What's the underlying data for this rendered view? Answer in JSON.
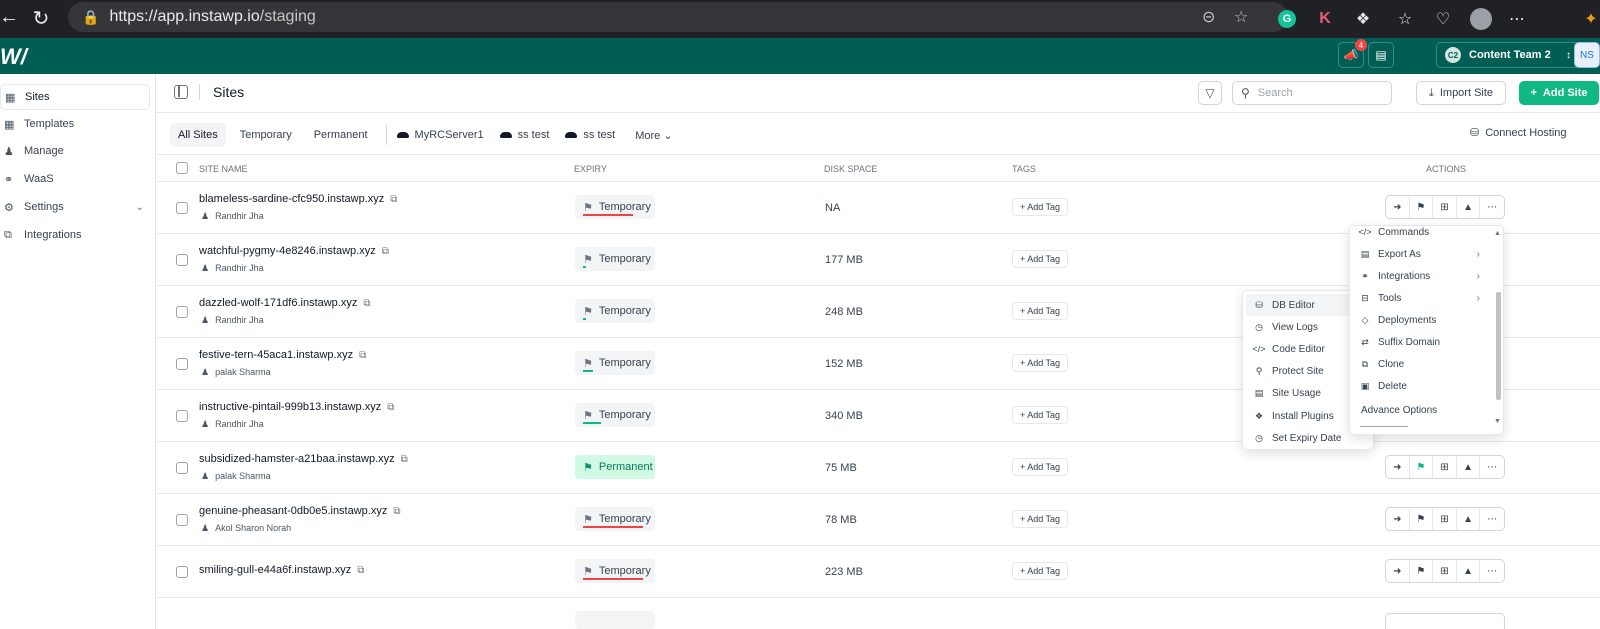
{
  "browser": {
    "url_host": "https://app.instawp.io",
    "url_path": "/staging"
  },
  "header": {
    "notifications_count": "4",
    "team_initials": "C2",
    "team_name": "Content Team 2",
    "user_initials": "NS"
  },
  "sidebar": {
    "items": [
      {
        "label": "Sites",
        "icon": "table-icon"
      },
      {
        "label": "Templates",
        "icon": "grid-icon"
      },
      {
        "label": "Manage",
        "icon": "users-icon"
      },
      {
        "label": "WaaS",
        "icon": "planet-icon"
      },
      {
        "label": "Settings",
        "icon": "gear-icon"
      },
      {
        "label": "Integrations",
        "icon": "plug-icon"
      }
    ]
  },
  "page": {
    "title": "Sites",
    "search_placeholder": "Search",
    "import_label": "Import Site",
    "add_label": "Add Site",
    "connect_label": "Connect Hosting"
  },
  "tabs": [
    "All Sites",
    "Temporary",
    "Permanent"
  ],
  "servers": [
    "MyRCServer1",
    "ss test",
    "ss test"
  ],
  "more_label": "More",
  "columns": {
    "name": "SITE NAME",
    "expiry": "EXPIRY",
    "disk": "DISK SPACE",
    "tags": "TAGS",
    "actions": "ACTIONS"
  },
  "add_tag_label": "+ Add Tag",
  "rows": [
    {
      "name": "blameless-sardine-cfc950.instawp.xyz",
      "owner": "Randhir Jha",
      "expiry": "Temporary",
      "disk": "NA"
    },
    {
      "name": "watchful-pygmy-4e8246.instawp.xyz",
      "owner": "Randhir Jha",
      "expiry": "Temporary",
      "disk": "177 MB"
    },
    {
      "name": "dazzled-wolf-171df6.instawp.xyz",
      "owner": "Randhir Jha",
      "expiry": "Temporary",
      "disk": "248 MB"
    },
    {
      "name": "festive-tern-45aca1.instawp.xyz",
      "owner": "palak Sharma",
      "expiry": "Temporary",
      "disk": "152 MB"
    },
    {
      "name": "instructive-pintail-999b13.instawp.xyz",
      "owner": "Randhir Jha",
      "expiry": "Temporary",
      "disk": "340 MB"
    },
    {
      "name": "subsidized-hamster-a21baa.instawp.xyz",
      "owner": "palak Sharma",
      "expiry": "Permanent",
      "disk": "75 MB"
    },
    {
      "name": "genuine-pheasant-0db0e5.instawp.xyz",
      "owner": "Akol Sharon Norah",
      "expiry": "Temporary",
      "disk": "78 MB"
    },
    {
      "name": "smiling-gull-e44a6f.instawp.xyz",
      "owner": "",
      "expiry": "Temporary",
      "disk": "223 MB"
    }
  ],
  "submenu": [
    "DB Editor",
    "View Logs",
    "Code Editor",
    "Protect Site",
    "Site Usage",
    "Install Plugins",
    "Set Expiry Date"
  ],
  "actions_menu": [
    "Commands",
    "Export As",
    "Integrations",
    "Tools",
    "Deployments",
    "Suffix Domain",
    "Clone",
    "Delete",
    "Advance Options"
  ],
  "colors": {
    "brand": "#005e54",
    "accent": "#10b981",
    "expiry_red": "#ef4444",
    "expiry_green": "#10b981"
  }
}
